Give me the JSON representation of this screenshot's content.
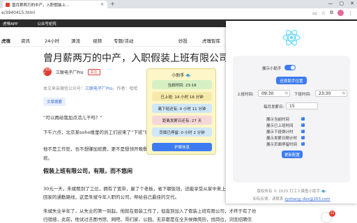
{
  "browser": {
    "tab_title": "曾月薪两万的中产，入职假装上...",
    "tab_close": "×",
    "new_tab": "+",
    "window_controls": [
      "—",
      "▢",
      "✕"
    ],
    "url": "e/3940415.html",
    "url_icons": [
      "cast-icon",
      "star-icon",
      "extensions-icon",
      "profile-icon",
      "menu-icon"
    ]
  },
  "bookmarks": [
    "虎嗅APP",
    "公众号矩阵"
  ],
  "site_nav": {
    "logo": "虎嗅",
    "items": [
      "资讯",
      "24小时",
      "源流",
      "视频",
      "专题/活动",
      "妙投",
      "虎嗅智库"
    ]
  },
  "article": {
    "title": "曾月薪两万的中产，入职假装上班有限公司",
    "author_avatar": "三联电子",
    "author": "三联电子厂Pro",
    "follow": "关注",
    "source_prefix": "本文来自微信公众号：",
    "source_link": "三联电子厂Pro",
    "source_suffix": "，作者：哈哈",
    "tag": "文章摘要",
    "quote": "“可以再给我加点活儿干吗？”",
    "para2": "下午六点，北京某soho楼里的员工们迎来了“下班”时刻，有的人",
    "para3": "他不是工作狂，也不想赚加班费，更不是想领开晚餐，张明曾是一家",
    "para3b": "班。",
    "subhead": "假装上班有限公司，有限，而不悠闲",
    "para4": "30元一天，朱斌租到了工位，拥有了宽带，雇了个老板，省下朝饭钱，还能享受从家中来上班的仪式感，",
    "para4b": "回家的通勤路线，这是朱斌今年入职的公司，帮给自己最佳的交代。",
    "para5a": "朱斌失业半年了，从失业的第一刻起，他就在假装工作了，但直到加入了假装上班有限公司，才终于有了份",
    "para5b": "归宿感，此前，他试过去图书馆、网吧、哥们家、公园，无非都是在全天候做简历，找岗位，浏览招聘信"
  },
  "helper": {
    "title": "小助手",
    "rows": [
      {
        "text": "当前时间: 23:16",
        "color": "#d6f0c4"
      },
      {
        "text": "已上班: 14 小时 16 分钟",
        "color": "#f7e9a8"
      },
      {
        "text": "离下班还有: 0 小时 11 分钟",
        "color": "#cfe7f7"
      },
      {
        "text": "距离发薪日还有: 27 天",
        "color": "#f6d7d7"
      },
      {
        "text": "页面已停留: 0 小时 2 分钟",
        "color": "#cfe7f7"
      }
    ],
    "rest_button": "护眼休息"
  },
  "popup": {
    "show_widget_label": "展示小助手",
    "show_widget_on": true,
    "position_button": "还原助手位置",
    "start_label": "上班时间:",
    "start_time": "09:30",
    "end_label": "下班时间:",
    "end_time": "23:30",
    "payday_label": "每月发薪日:",
    "payday_value": "15",
    "checkboxes": [
      {
        "label": "展示当前时间",
        "checked": true
      },
      {
        "label": "展示已上班时间",
        "checked": true
      },
      {
        "label": "展示下班倒计时",
        "checked": true
      },
      {
        "label": "展示发薪日倒计时",
        "checked": true
      },
      {
        "label": "展示页面停留时间",
        "checked": true
      }
    ],
    "save_button": "更新配置",
    "footer_copyright": "版权所有 © 2025 打工人摸鱼小助手 🐟",
    "footer_contact_prefix": "如有反馈，请联系 ",
    "footer_contact_email": "zyzhang_dev@163.com"
  },
  "colors": {
    "accent": "#3d7cf0",
    "brand_red": "#e03c31",
    "helper_bg": "#fcf6c8"
  }
}
